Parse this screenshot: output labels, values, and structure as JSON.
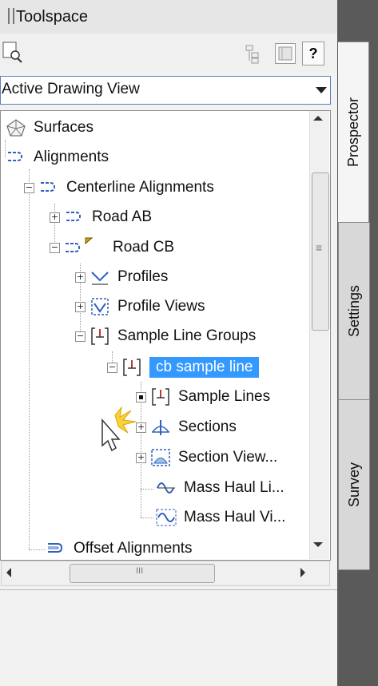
{
  "window": {
    "title": "Toolspace"
  },
  "toolbar": {
    "icons": [
      "find-icon",
      "item-view-icon",
      "list-view-icon",
      "help-icon"
    ],
    "help_label": "?"
  },
  "view_selector": {
    "selected": "Active Drawing View"
  },
  "tree": {
    "surfaces": "Surfaces",
    "alignments": "Alignments",
    "centerline_alignments": "Centerline Alignments",
    "road_ab": "Road AB",
    "road_cb": "Road CB",
    "profiles": "Profiles",
    "profile_views": "Profile Views",
    "sample_line_groups": "Sample Line Groups",
    "cb_sample_line": "cb sample line",
    "sample_lines": "Sample Lines",
    "sections": "Sections",
    "section_views": "Section View...",
    "mass_haul_lines": "Mass Haul Li...",
    "mass_haul_views": "Mass Haul Vi...",
    "offset_alignments": "Offset Alignments"
  },
  "tabs": {
    "prospector": "Prospector",
    "settings": "Settings",
    "survey": "Survey"
  },
  "scrollbar": {
    "grip": "≡",
    "h_grip": "III"
  },
  "colors": {
    "selection": "#3399ff",
    "alignment_icon": "#2f5fbf",
    "sample_icon": "#c0392b"
  }
}
